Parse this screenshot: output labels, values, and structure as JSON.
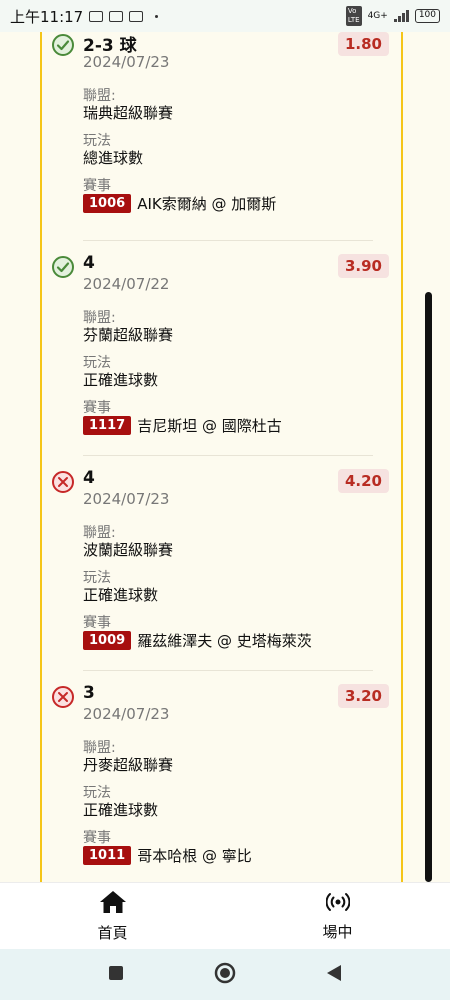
{
  "status_bar": {
    "time": "上午11:17",
    "network": "4G+",
    "battery": "100"
  },
  "bets": [
    {
      "result": "won",
      "pick": "2-3 球",
      "date": "2024/07/23",
      "odds": "1.80",
      "league_label": "聯盟:",
      "league": "瑞典超級聯賽",
      "play_label": "玩法",
      "play": "總進球數",
      "match_label": "賽事",
      "match_no": "1006",
      "match_name": "AIK索爾納 @ 加爾斯"
    },
    {
      "result": "won",
      "pick": "4",
      "date": "2024/07/22",
      "odds": "3.90",
      "league_label": "聯盟:",
      "league": "芬蘭超級聯賽",
      "play_label": "玩法",
      "play": "正確進球數",
      "match_label": "賽事",
      "match_no": "1117",
      "match_name": "吉尼斯坦 @ 國際杜古"
    },
    {
      "result": "lost",
      "pick": "4",
      "date": "2024/07/23",
      "odds": "4.20",
      "league_label": "聯盟:",
      "league": "波蘭超級聯賽",
      "play_label": "玩法",
      "play": "正確進球數",
      "match_label": "賽事",
      "match_no": "1009",
      "match_name": "羅茲維澤夫 @ 史塔梅萊茨"
    },
    {
      "result": "lost",
      "pick": "3",
      "date": "2024/07/23",
      "odds": "3.20",
      "league_label": "聯盟:",
      "league": "丹麥超級聯賽",
      "play_label": "玩法",
      "play": "正確進球數",
      "match_label": "賽事",
      "match_no": "1011",
      "match_name": "哥本哈根 @ 寧比"
    }
  ],
  "bottom_nav": {
    "home": {
      "label": "首頁",
      "icon": "home-icon"
    },
    "live": {
      "label": "場中",
      "icon": "broadcast-icon"
    }
  },
  "colors": {
    "accent_rail": "#f5c518",
    "odds_text": "#b82c22",
    "match_badge": "#a70f0f",
    "won": "#4a8a3a",
    "lost": "#c62828"
  }
}
